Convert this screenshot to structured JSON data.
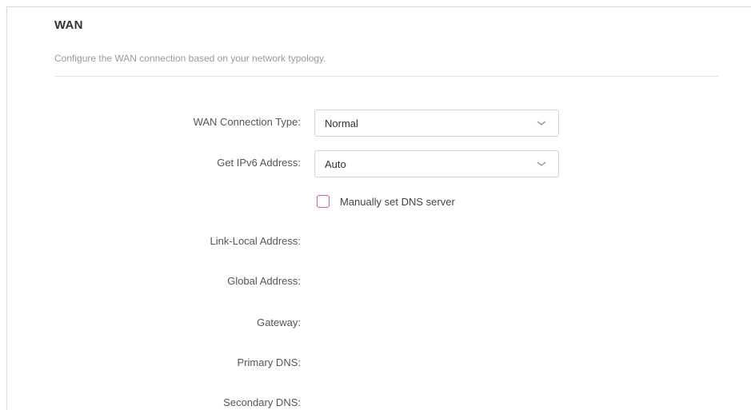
{
  "section": {
    "title": "WAN",
    "description": "Configure the WAN connection based on your network typology."
  },
  "form": {
    "wan_connection_type": {
      "label": "WAN Connection Type:",
      "value": "Normal"
    },
    "get_ipv6_address": {
      "label": "Get IPv6 Address:",
      "value": "Auto"
    },
    "manual_dns": {
      "label": "Manually set DNS server",
      "checked": false
    },
    "fields": {
      "link_local_address": {
        "label": "Link-Local Address:"
      },
      "global_address": {
        "label": "Global Address:"
      },
      "gateway": {
        "label": "Gateway:"
      },
      "primary_dns": {
        "label": "Primary DNS:"
      },
      "secondary_dns": {
        "label": "Secondary DNS:"
      }
    }
  },
  "colors": {
    "checkbox_border": "#c46a77",
    "divider": "#e2e2e2",
    "select_border": "#d4d4d4"
  }
}
